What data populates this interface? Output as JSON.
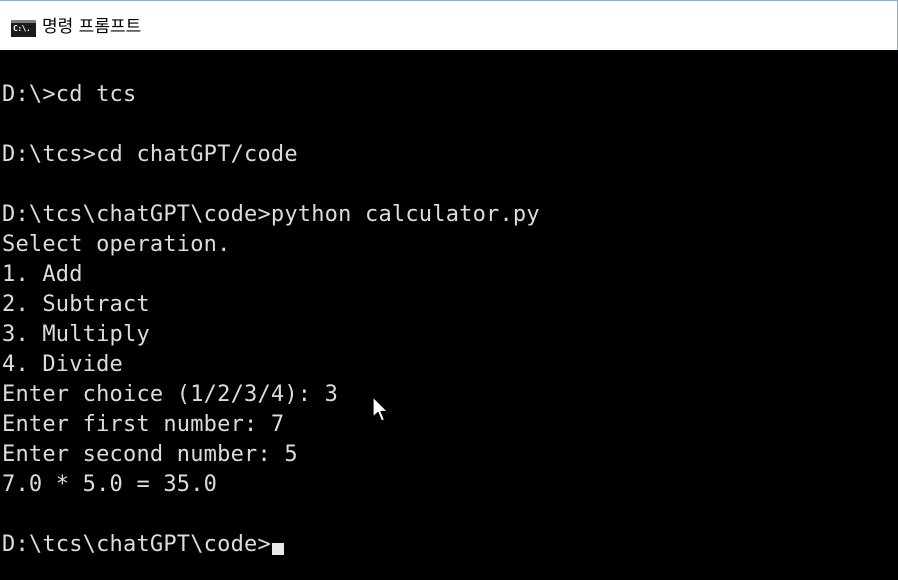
{
  "window": {
    "title": "명령 프롬프트",
    "icon": "cmd-window-icon",
    "icon_glyph": "C:\\."
  },
  "console": {
    "lines": [
      "D:\\>cd tcs",
      "",
      "D:\\tcs>cd chatGPT/code",
      "",
      "D:\\tcs\\chatGPT\\code>python calculator.py",
      "Select operation.",
      "1. Add",
      "2. Subtract",
      "3. Multiply",
      "4. Divide",
      "Enter choice (1/2/3/4): 3",
      "Enter first number: 7",
      "Enter second number: 5",
      "7.0 * 5.0 = 35.0",
      ""
    ],
    "prompt": "D:\\tcs\\chatGPT\\code>"
  },
  "colors": {
    "background": "#000000",
    "text": "#dcdcdc",
    "titlebar": "#ffffff"
  },
  "pointer": "mouse-arrow-pointer"
}
